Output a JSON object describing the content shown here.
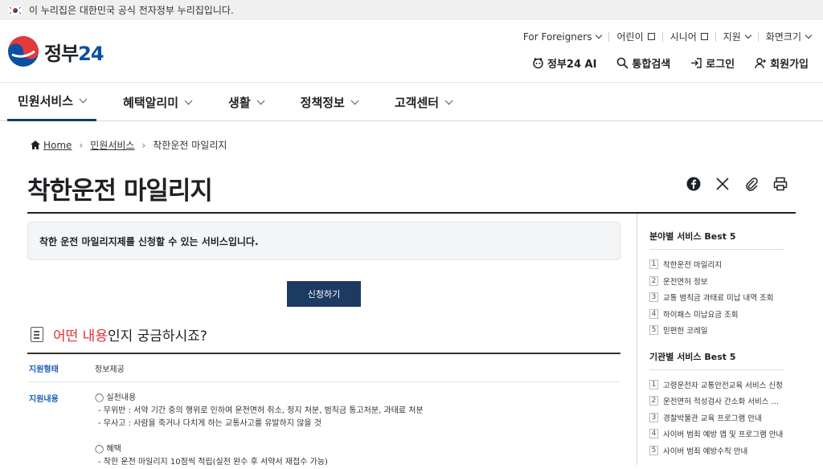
{
  "banner": {
    "text": "이 누리집은 대한민국 공식 전자정부 누리집입니다."
  },
  "logo": {
    "text_a": "정부",
    "text_b": "24"
  },
  "util": {
    "foreigners": "For Foreigners",
    "kids": "어린이",
    "senior": "시니어",
    "support": "지원",
    "zoom": "화면크기"
  },
  "actions": {
    "ai": "정부24 AI",
    "search": "통합검색",
    "login": "로그인",
    "signup": "회원가입"
  },
  "gnb": [
    {
      "label": "민원서비스"
    },
    {
      "label": "혜택알리미"
    },
    {
      "label": "생활"
    },
    {
      "label": "정책정보"
    },
    {
      "label": "고객센터"
    }
  ],
  "breadcrumb": {
    "home": "Home",
    "l1": "민원서비스",
    "current": "착한운전 마일리지"
  },
  "page": {
    "title": "착한운전 마일리지",
    "summary": "착한 운전 마일리지제를 신청할 수 있는 서비스입니다.",
    "apply": "신청하기",
    "question_red": "어떤 내용",
    "question_rest": "인지 궁금하시죠?"
  },
  "details": {
    "type_key": "지원형태",
    "type_val": "정보제공",
    "content_key": "지원내용",
    "lines": [
      "◯ 실천내용",
      "- 무위반 : 서약 기간 중의 행위로 인하여 운전면허 취소, 정지 처분, 범칙금 통고처분, 과태료 처분",
      "- 무사고 : 사람을 죽거나 다치게 하는 교통사고를 유발하지 않을 것",
      "",
      "◯ 혜택",
      "- 착한 운전 마일리지 10점씩 적립(실천 완수 후 서약서 재접수 가능)"
    ]
  },
  "sidebar": {
    "best_field_title": "분야별 서비스 Best 5",
    "best_field": [
      "착한운전 마일리지",
      "운전면허 정보",
      "교통 범칙금 과태료 미납 내역 조회",
      "하이패스 미납요금 조회",
      "믿편한 코레일"
    ],
    "best_org_title": "기관별 서비스 Best 5",
    "best_org": [
      "고령운전자 교통안전교육 서비스 신청",
      "운전면허 적성검사 간소화 서비스 신청",
      "경찰박물관 교육 프로그램 안내",
      "사이버 범죄 예방 앱 및 프로그램 안내",
      "사이버 범죄 예방수칙 안내"
    ],
    "numbers": [
      "1",
      "2",
      "3",
      "4",
      "5"
    ]
  }
}
